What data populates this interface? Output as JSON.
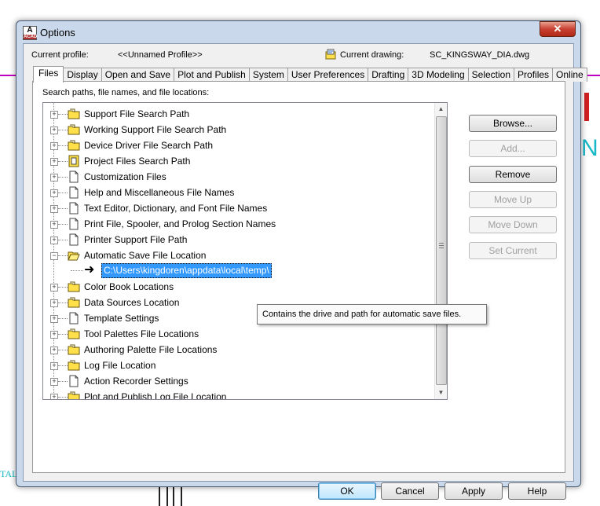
{
  "window": {
    "title": "Options",
    "close_glyph": "✕"
  },
  "profile": {
    "current_profile_label": "Current profile:",
    "current_profile_value": "<<Unnamed Profile>>",
    "current_drawing_label": "Current drawing:",
    "current_drawing_value": "SC_KINGSWAY_DIA.dwg"
  },
  "tabs": [
    {
      "label": "Files",
      "active": true
    },
    {
      "label": "Display"
    },
    {
      "label": "Open and Save"
    },
    {
      "label": "Plot and Publish"
    },
    {
      "label": "System"
    },
    {
      "label": "User Preferences"
    },
    {
      "label": "Drafting"
    },
    {
      "label": "3D Modeling"
    },
    {
      "label": "Selection"
    },
    {
      "label": "Profiles"
    },
    {
      "label": "Online"
    }
  ],
  "files_panel": {
    "caption": "Search paths, file names, and file locations:",
    "tree": [
      {
        "label": "Support File Search Path",
        "icon": "folder-icon",
        "expander": "+"
      },
      {
        "label": "Working Support File Search Path",
        "icon": "folder-icon",
        "expander": "+"
      },
      {
        "label": "Device Driver File Search Path",
        "icon": "folder-icon",
        "expander": "+"
      },
      {
        "label": "Project Files Search Path",
        "icon": "project-icon",
        "expander": "+"
      },
      {
        "label": "Customization Files",
        "icon": "document-icon",
        "expander": "+"
      },
      {
        "label": "Help and Miscellaneous File Names",
        "icon": "document-icon",
        "expander": "+"
      },
      {
        "label": "Text Editor, Dictionary, and Font File Names",
        "icon": "document-icon",
        "expander": "+"
      },
      {
        "label": "Print File, Spooler, and Prolog Section Names",
        "icon": "document-icon",
        "expander": "+"
      },
      {
        "label": "Printer Support File Path",
        "icon": "document-icon",
        "expander": "+"
      },
      {
        "label": "Automatic Save File Location",
        "icon": "open-folder-icon",
        "expander": "−"
      },
      {
        "label": "Color Book Locations",
        "icon": "folder-icon",
        "expander": "+"
      },
      {
        "label": "Data Sources Location",
        "icon": "folder-icon",
        "expander": "+"
      },
      {
        "label": "Template Settings",
        "icon": "document-icon",
        "expander": "+"
      },
      {
        "label": "Tool Palettes File Locations",
        "icon": "folder-icon",
        "expander": "+"
      },
      {
        "label": "Authoring Palette File Locations",
        "icon": "folder-icon",
        "expander": "+"
      },
      {
        "label": "Log File Location",
        "icon": "folder-icon",
        "expander": "+"
      },
      {
        "label": "Action Recorder Settings",
        "icon": "document-icon",
        "expander": "+"
      },
      {
        "label": "Plot and Publish Log File Location",
        "icon": "folder-icon",
        "expander": "+"
      }
    ],
    "selected_child": "C:\\Users\\kingdoren\\appdata\\local\\temp\\",
    "tooltip": "Contains the drive and path for automatic save files."
  },
  "side_buttons": {
    "browse": "Browse...",
    "add": "Add...",
    "remove": "Remove",
    "move_up": "Move Up",
    "move_down": "Move Down",
    "set_current": "Set Current"
  },
  "footer_buttons": {
    "ok": "OK",
    "cancel": "Cancel",
    "apply": "Apply",
    "help": "Help"
  },
  "background": {
    "right_letter": "N",
    "left_text": "TAL"
  },
  "colors": {
    "selection": "#3399ff",
    "folder_yellow": "#ffe04a",
    "cad_magenta": "#c000c0",
    "cad_cyan": "#18b8c8"
  }
}
